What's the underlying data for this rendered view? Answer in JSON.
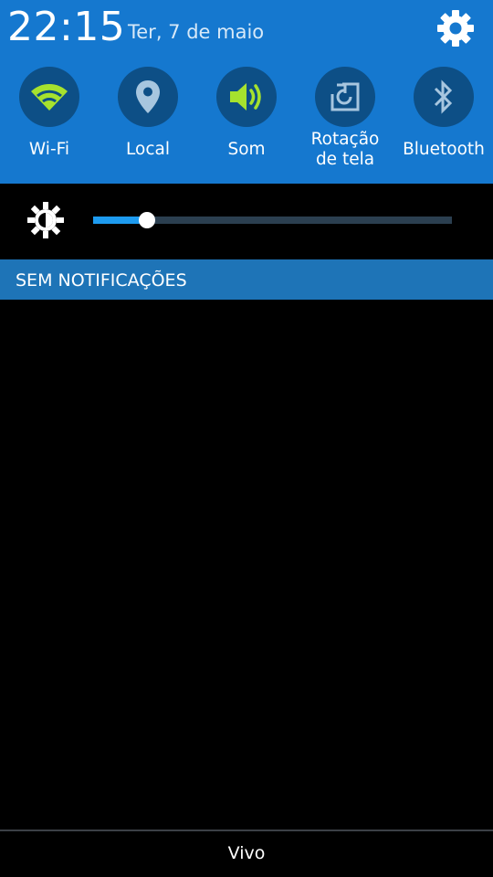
{
  "header": {
    "time": "22:15",
    "date": "Ter, 7 de maio",
    "settings_icon": "gear-icon"
  },
  "toggles": [
    {
      "label": "Wi-Fi",
      "icon": "wifi-icon",
      "active": true,
      "icon_color": "#a6e22e"
    },
    {
      "label": "Local",
      "icon": "location-pin-icon",
      "active": false,
      "icon_color": "#a7c6df"
    },
    {
      "label": "Som",
      "icon": "speaker-icon",
      "active": true,
      "icon_color": "#a6e22e"
    },
    {
      "label": "Rotação",
      "label2": "de tela",
      "icon": "screen-rotation-icon",
      "active": false,
      "icon_color": "#a7c6df"
    },
    {
      "label": "Bluetooth",
      "icon": "bluetooth-icon",
      "active": false,
      "icon_color": "#a7c6df"
    }
  ],
  "brightness": {
    "icon": "brightness-icon",
    "level": 0.15
  },
  "notifications": {
    "title": "SEM NOTIFICAÇÕES"
  },
  "carrier": {
    "name": "Vivo"
  },
  "colors": {
    "header_bg": "#1578cf",
    "toggle_bg": "#0d4f86",
    "active_icon": "#a6e22e",
    "inactive_icon": "#a7c6df",
    "notif_bar": "#1e74b7",
    "slider_fill": "#1d9bf0"
  }
}
